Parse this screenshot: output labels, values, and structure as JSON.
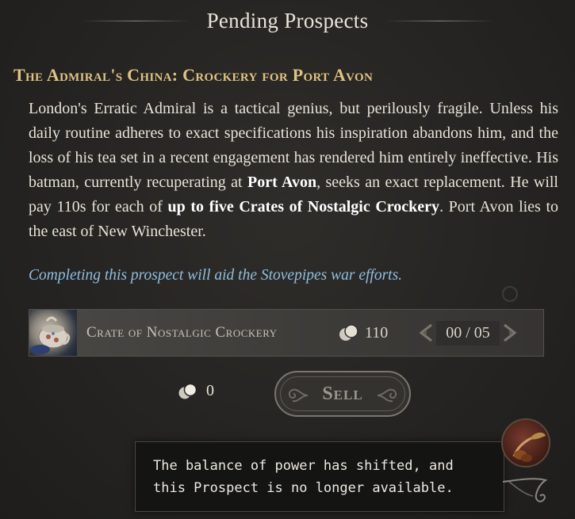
{
  "header": {
    "title": "Pending Prospects"
  },
  "prospect": {
    "title": "The Admiral's China: Crockery for Port Avon",
    "description_part1": "London's Erratic Admiral is a tactical genius, but perilously fragile. Unless his daily routine adheres to exact specifications his inspiration abandons him, and the loss of his tea set in a recent engagement has rendered him entirely ineffective. His batman, currently recuperating at ",
    "bold_location": "Port Avon",
    "description_part2": ", seeks an exact replacement. He will pay 110s for each of ",
    "bold_amount": "up to five Crates of Nostalgic Crockery",
    "description_part3": ". Port Avon lies to the east of New Winchester.",
    "note": "Completing this prospect will aid the Stovepipes war efforts."
  },
  "item": {
    "name": "Crate of Nostalgic Crockery",
    "price": "110",
    "quantity": "00 / 05",
    "icon": "teacup-crate-icon"
  },
  "totals": {
    "value": "0",
    "icon": "coins-icon"
  },
  "sell_button": {
    "label": "Sell"
  },
  "toast": {
    "message": "The balance of power has shifted, and this Prospect is no longer available."
  },
  "colors": {
    "title_gold": "#e0c382",
    "note_blue": "#8fbde0",
    "background": "#252422",
    "toast_bg": "#141413"
  }
}
